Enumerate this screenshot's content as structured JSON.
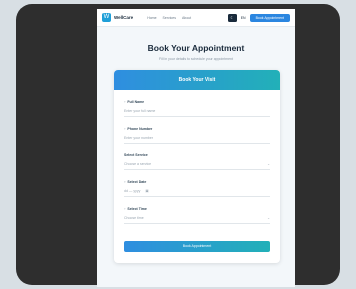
{
  "nav": {
    "logo_glyph": "W",
    "brand": "WellCare",
    "links": [
      "Home",
      "Services",
      "About"
    ],
    "theme_glyph": "☾",
    "lang": "EN",
    "cta": "Book Appointment"
  },
  "hero": {
    "title": "Book Your Appointment",
    "subtitle": "Fill in your details to schedule your appointment"
  },
  "form": {
    "header": "Book Your Visit",
    "full_name": {
      "label": "Full Name",
      "placeholder": "Enter your full name",
      "icon": "person-icon"
    },
    "phone": {
      "label": "Phone Number",
      "placeholder": "Enter your number",
      "icon": "phone-icon"
    },
    "service": {
      "label": "Select Service",
      "value": "Choose a service"
    },
    "date": {
      "label": "Select Date",
      "value": "dd — yyyy"
    },
    "time": {
      "label": "Select Time",
      "value": "Choose time"
    },
    "submit": "Book Appointment"
  },
  "colors": {
    "brand": "#1f9fd8",
    "gradient_start": "#2f8ee0",
    "gradient_end": "#22b0b8"
  }
}
